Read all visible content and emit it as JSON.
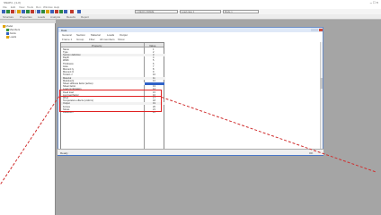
{
  "window": {
    "title": "SNAP4 - [1-3]",
    "controls": "– □ ×"
  },
  "menu": [
    "File",
    "Edit",
    "View",
    "Tools",
    "Run",
    "Window",
    "Help"
  ],
  "toolbar": {
    "combo_a": "1:DECK-FRAME",
    "combo_b": "Load case 1",
    "combo_c": "Mode 1"
  },
  "toolbar2": {
    "items": [
      "Structure",
      "Properties",
      "Loads",
      "Analysis",
      "Results",
      "Report"
    ]
  },
  "tree": {
    "header": "Project",
    "nodes": [
      "Model",
      "Members",
      "Joints",
      "Loads"
    ]
  },
  "dialog": {
    "title": "Data",
    "tabs": [
      "General",
      "Section",
      "Material",
      "Loads",
      "Output"
    ],
    "toolbar2": [
      "Frame 1",
      "Group",
      "Filter",
      "All members",
      "Show"
    ],
    "grid_headers": {
      "name": "Property",
      "value": "Value"
    },
    "rows": [
      {
        "label": "Name",
        "value": "1",
        "group": false
      },
      {
        "label": "Type",
        "value": "2",
        "group": false
      },
      {
        "label": "Section definition",
        "value": "3",
        "group": true
      },
      {
        "label": "Depth",
        "value": "4",
        "group": false
      },
      {
        "label": "Width",
        "value": "5",
        "group": false
      },
      {
        "label": "Thickness",
        "value": "6",
        "group": false
      },
      {
        "label": "Area",
        "value": "7",
        "group": false
      },
      {
        "label": "Moment Iy",
        "value": "8",
        "group": false
      },
      {
        "label": "Moment Iz",
        "value": "9",
        "group": false
      },
      {
        "label": "Torsion J",
        "value": "10",
        "group": false
      },
      {
        "label": "Material",
        "value": "11",
        "group": true
      },
      {
        "label": "Modulus E",
        "value": "12",
        "group": false
      },
      {
        "label": "Shear stiffness factor (active)",
        "value": "",
        "group": true,
        "active": true
      },
      {
        "label": "Shear factor",
        "value": "13",
        "group": false
      },
      {
        "label": "Load combination",
        "value": "14",
        "group": false
      },
      {
        "label": "Dead load",
        "value": "15",
        "group": false
      },
      {
        "label": "Live load factor",
        "value": "16",
        "group": false
      },
      {
        "label": "Wind",
        "value": "17",
        "group": false
      },
      {
        "label": "Temperature effects (uniform)",
        "value": "18",
        "group": false
      },
      {
        "label": "Output",
        "value": "19",
        "group": true
      },
      {
        "label": "Forces",
        "value": "20",
        "group": false
      },
      {
        "label": "Stress",
        "value": "21",
        "group": false
      },
      {
        "label": "Deflection",
        "value": "22",
        "group": false
      }
    ]
  },
  "statusbar": {
    "left": "Ready",
    "right": "OK"
  },
  "colors": {
    "highlight": "#e02020",
    "selected_value": "#2f62c8",
    "titlebar_accent": "#dfe9f8"
  }
}
